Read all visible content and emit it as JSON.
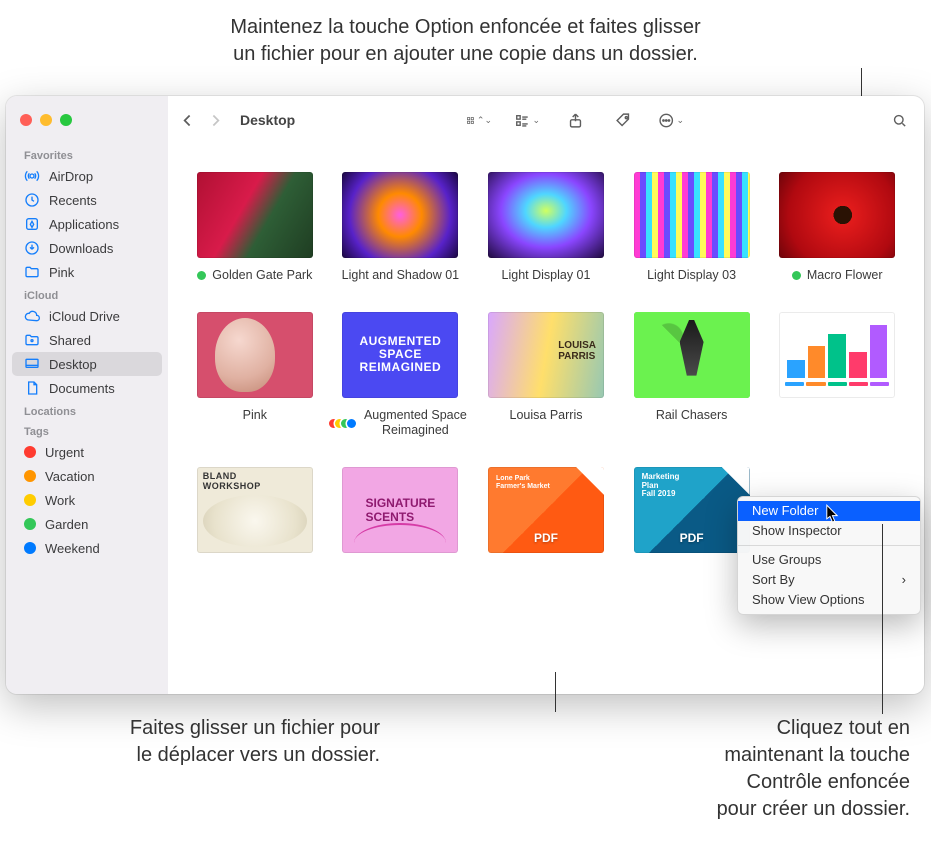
{
  "callouts": {
    "top": "Maintenez la touche Option enfoncée et faites glisser\nun fichier pour en ajouter une copie dans un dossier.",
    "bottom_left": "Faites glisser un fichier pour\nle déplacer vers un dossier.",
    "bottom_right": "Cliquez tout en\nmaintenant la touche\nContrôle enfoncée\npour créer un dossier."
  },
  "window": {
    "path_title": "Desktop"
  },
  "sidebar": {
    "favorites_header": "Favorites",
    "icloud_header": "iCloud",
    "locations_header": "Locations",
    "tags_header": "Tags",
    "favorites": [
      {
        "label": "AirDrop"
      },
      {
        "label": "Recents"
      },
      {
        "label": "Applications"
      },
      {
        "label": "Downloads"
      },
      {
        "label": "Pink"
      }
    ],
    "icloud": [
      {
        "label": "iCloud Drive"
      },
      {
        "label": "Shared"
      },
      {
        "label": "Desktop",
        "selected": true
      },
      {
        "label": "Documents"
      }
    ],
    "tags": [
      {
        "label": "Urgent",
        "color": "#ff3b30"
      },
      {
        "label": "Vacation",
        "color": "#ff9500"
      },
      {
        "label": "Work",
        "color": "#ffcc00"
      },
      {
        "label": "Garden",
        "color": "#34c759"
      },
      {
        "label": "Weekend",
        "color": "#007aff"
      }
    ]
  },
  "files": [
    {
      "label": "Golden Gate Park",
      "tag": "#34c759",
      "thumb": "th-flowers"
    },
    {
      "label": "Light and Shadow 01",
      "thumb": "th-light1"
    },
    {
      "label": "Light Display 01",
      "thumb": "th-light2"
    },
    {
      "label": "Light Display 03",
      "thumb": "th-light3"
    },
    {
      "label": "Macro Flower",
      "tag": "#34c759",
      "thumb": "th-macro"
    },
    {
      "label": "Pink",
      "thumb": "th-pink"
    },
    {
      "label": "Augmented Space Reimagined",
      "multi_tags": [
        "#ff3b30",
        "#ffcc00",
        "#34c759",
        "#007aff"
      ],
      "thumb": "th-aug",
      "thumb_text": "AUGMENTED\nSPACE\nREIMAGINED"
    },
    {
      "label": "Louisa Parris",
      "thumb": "th-louisa"
    },
    {
      "label": "Rail Chasers",
      "thumb": "th-rail"
    },
    {
      "label": "",
      "thumb": "th-chart"
    },
    {
      "label": "",
      "thumb": "th-bland",
      "thumb_text": "BLAND\nWORKSHOP"
    },
    {
      "label": "",
      "thumb": "th-scents",
      "thumb_text": "SIGNATURE\nSCENTS"
    },
    {
      "label": "",
      "thumb": "th-pdf1",
      "thumb_text": "Lone Park\nFarmer's Market"
    },
    {
      "label": "",
      "thumb": "th-pdf2",
      "thumb_text": "Marketing\nPlan\nFall 2019"
    }
  ],
  "context_menu": {
    "items": [
      {
        "label": "New Folder",
        "selected": true
      },
      {
        "label": "Show Inspector"
      },
      {
        "label": "Use Groups"
      },
      {
        "label": "Sort By",
        "submenu": true
      },
      {
        "label": "Show View Options"
      }
    ]
  }
}
